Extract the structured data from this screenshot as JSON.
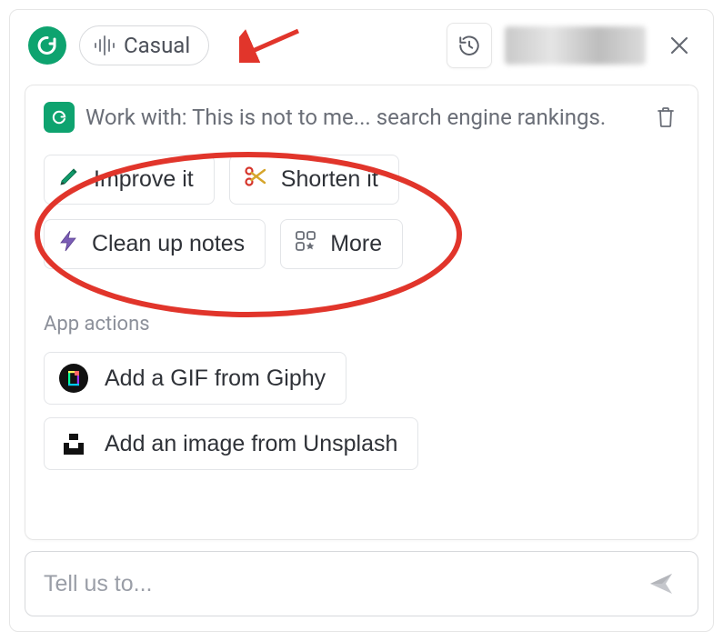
{
  "header": {
    "tone_label": "Casual"
  },
  "panel": {
    "work_with_text": "Work with: This is not to me... search engine rankings.",
    "actions": {
      "improve": "Improve it",
      "shorten": "Shorten it",
      "clean": "Clean up notes",
      "more": "More"
    },
    "app_actions_label": "App actions",
    "app_actions": {
      "giphy": "Add a GIF from Giphy",
      "unsplash": "Add an image from Unsplash"
    }
  },
  "input": {
    "placeholder": "Tell us to..."
  },
  "annotation": {
    "arrow_color": "#e1352b",
    "ellipse_color": "#e1352b"
  }
}
